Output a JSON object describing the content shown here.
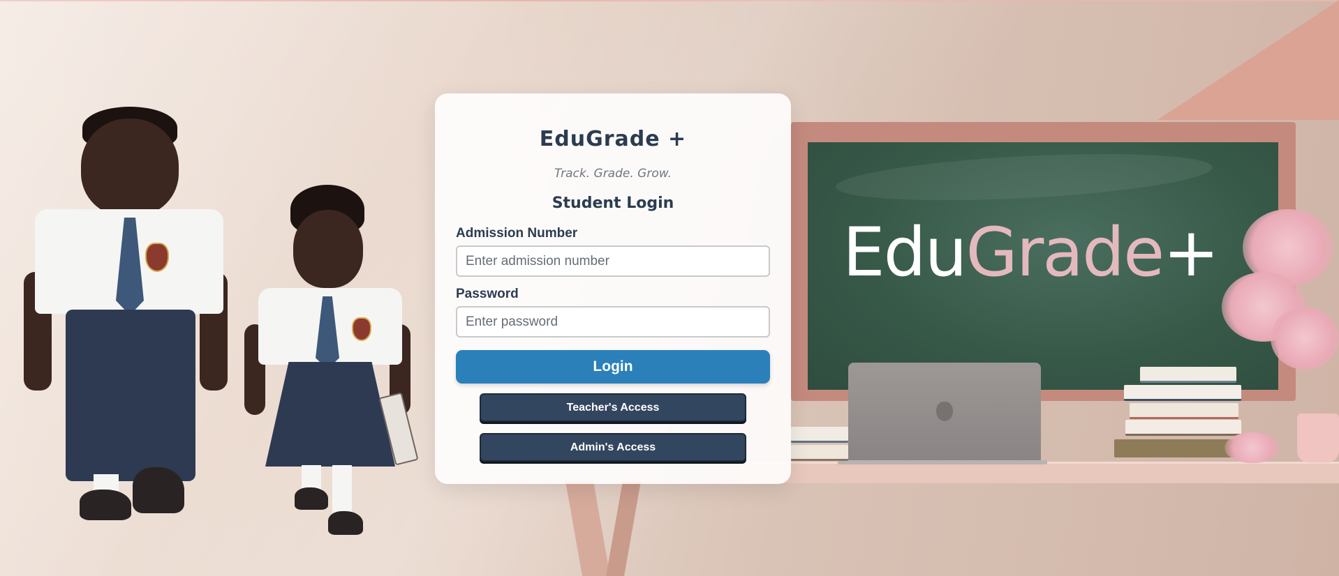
{
  "background": {
    "board_logo": {
      "part1": "Edu",
      "part2": "Grade",
      "part3": "+"
    }
  },
  "login_card": {
    "title": "EduGrade +",
    "tagline": "Track. Grade. Grow.",
    "heading": "Student Login",
    "admission": {
      "label": "Admission Number",
      "placeholder": "Enter admission number",
      "value": ""
    },
    "password": {
      "label": "Password",
      "placeholder": "Enter password",
      "value": ""
    },
    "login_button": "Login",
    "teacher_button": "Teacher's Access",
    "admin_button": "Admin's Access"
  },
  "colors": {
    "primary_button": "#2b80ba",
    "secondary_button": "#33465f",
    "heading_text": "#2b3c50"
  }
}
